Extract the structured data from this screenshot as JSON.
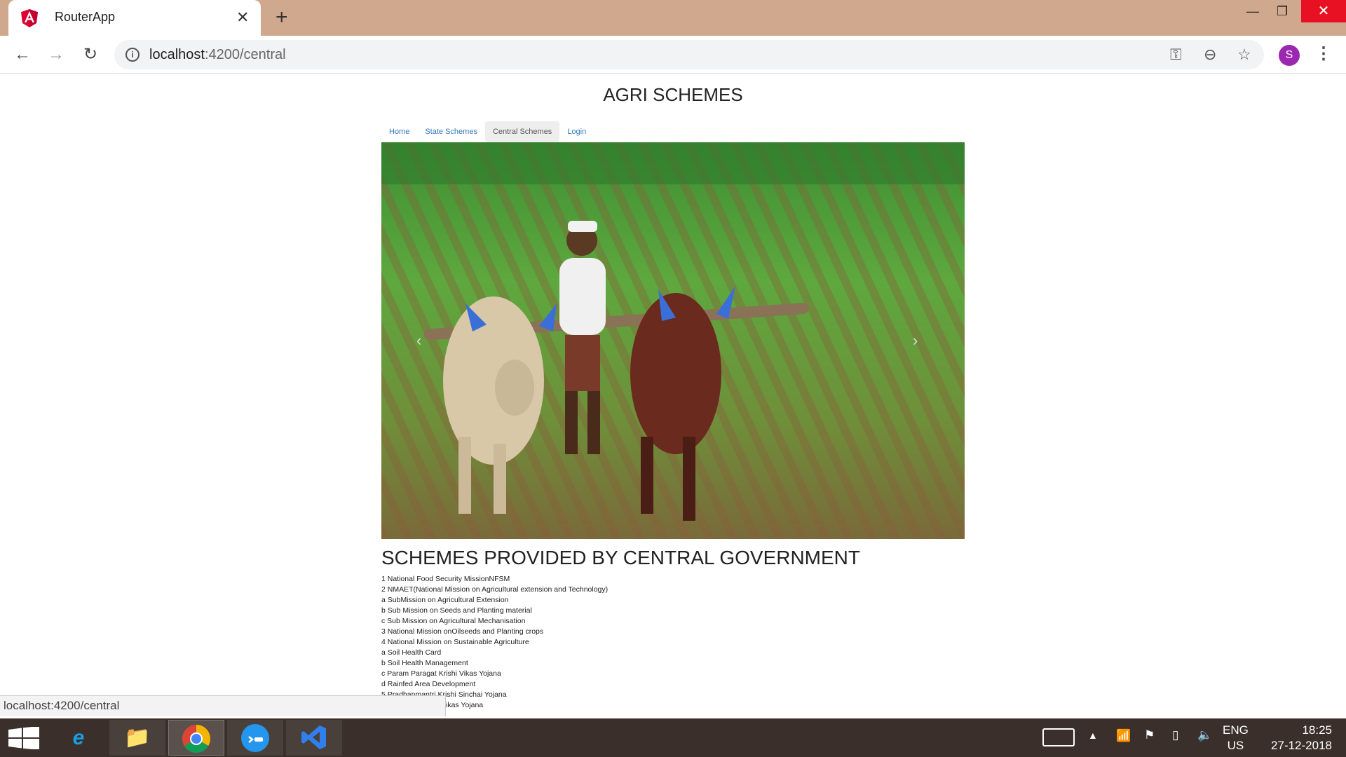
{
  "browser": {
    "tab_title": "RouterApp",
    "url_host": "localhost",
    "url_rest": ":4200/central",
    "profile_initial": "S",
    "status_url": "localhost:4200/central"
  },
  "page": {
    "title": "AGRI SCHEMES",
    "nav": [
      {
        "label": "Home",
        "active": false
      },
      {
        "label": "State Schemes",
        "active": false
      },
      {
        "label": "Central Schemes",
        "active": true
      },
      {
        "label": "Login",
        "active": false
      }
    ],
    "heading": "SCHEMES PROVIDED BY CENTRAL GOVERNMENT",
    "schemes": [
      "1 National Food Security MissionNFSM",
      "2 NMAET(National Mission on Agricultural extension and Technology)",
      "a SubMission on Agricultural Extension",
      "b Sub Mission on Seeds and Planting material",
      "c Sub Mission on Agricultural Mechanisation",
      "3 National Mission onOilseeds and Planting crops",
      "4 National Mission on Sustainable Agriculture",
      "a Soil Health Card",
      "b Soil Health Management",
      "c Param Paragat Krishi Vikas Yojana",
      "d Rainfed Area Development",
      "5 Pradhanmantri Krishi Sinchai Yojana",
      "6 Rashtriya Krishi Vikas Yojana"
    ]
  },
  "taskbar": {
    "lang_top": "ENG",
    "lang_bottom": "US",
    "time": "18:25",
    "date": "27-12-2018"
  },
  "colors": {
    "titlebar": "#cfa88e",
    "link": "#337ab7",
    "close_button": "#e81123",
    "taskbar": "#3a2f2a",
    "avatar": "#9c27b0"
  }
}
